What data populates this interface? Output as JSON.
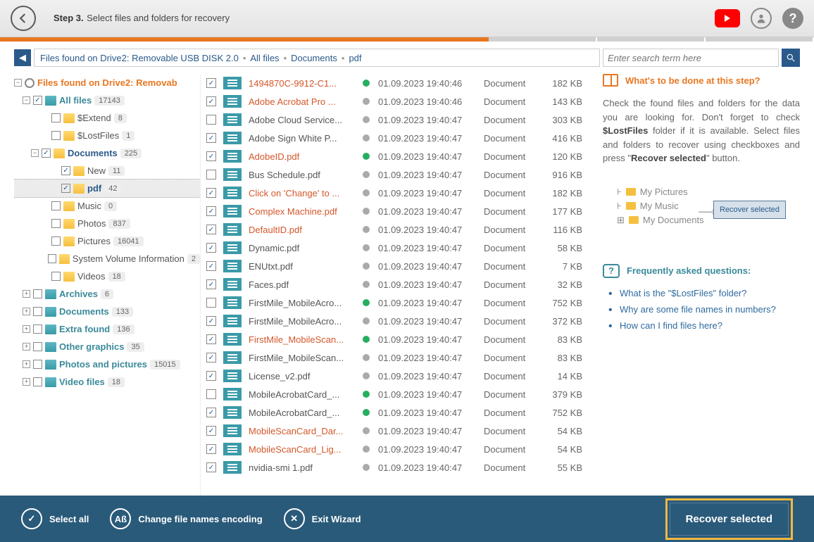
{
  "header": {
    "step": "Step 3.",
    "title": "Select files and folders for recovery"
  },
  "breadcrumb": {
    "root": "Files found on Drive2: Removable USB DISK 2.0",
    "p1": "All files",
    "p2": "Documents",
    "p3": "pdf"
  },
  "search": {
    "placeholder": "Enter search term here"
  },
  "tree": {
    "root": {
      "label": "Files found on Drive2: Removab"
    },
    "allfiles": {
      "label": "All files",
      "count": "17143"
    },
    "extend": {
      "label": "$Extend",
      "count": "8"
    },
    "lostfiles": {
      "label": "$LostFiles",
      "count": "1"
    },
    "documents": {
      "label": "Documents",
      "count": "225"
    },
    "new": {
      "label": "New",
      "count": "11"
    },
    "pdf": {
      "label": "pdf",
      "count": "42"
    },
    "music": {
      "label": "Music",
      "count": "0"
    },
    "photos": {
      "label": "Photos",
      "count": "837"
    },
    "pictures": {
      "label": "Pictures",
      "count": "16041"
    },
    "svi": {
      "label": "System Volume Information",
      "count": "2"
    },
    "videos": {
      "label": "Videos",
      "count": "18"
    },
    "archives": {
      "label": "Archives",
      "count": "6"
    },
    "docs2": {
      "label": "Documents",
      "count": "133"
    },
    "extrafound": {
      "label": "Extra found",
      "count": "136"
    },
    "othergfx": {
      "label": "Other graphics",
      "count": "35"
    },
    "photospics": {
      "label": "Photos and pictures",
      "count": "15015"
    },
    "videofiles": {
      "label": "Video files",
      "count": "18"
    }
  },
  "files": [
    {
      "chk": true,
      "name": "1494870C-9912-C1...",
      "health": "green",
      "date": "01.09.2023 19:40:46",
      "type": "Document",
      "size": "182 KB",
      "orange": true
    },
    {
      "chk": true,
      "name": "Adobe Acrobat Pro ...",
      "health": "gray",
      "date": "01.09.2023 19:40:46",
      "type": "Document",
      "size": "143 KB",
      "orange": true
    },
    {
      "chk": false,
      "name": "Adobe Cloud Service...",
      "health": "gray",
      "date": "01.09.2023 19:40:47",
      "type": "Document",
      "size": "303 KB",
      "orange": false
    },
    {
      "chk": true,
      "name": "Adobe Sign White P...",
      "health": "gray",
      "date": "01.09.2023 19:40:47",
      "type": "Document",
      "size": "416 KB",
      "orange": false
    },
    {
      "chk": true,
      "name": "AdobeID.pdf",
      "health": "green",
      "date": "01.09.2023 19:40:47",
      "type": "Document",
      "size": "120 KB",
      "orange": true
    },
    {
      "chk": false,
      "name": "Bus Schedule.pdf",
      "health": "gray",
      "date": "01.09.2023 19:40:47",
      "type": "Document",
      "size": "916 KB",
      "orange": false
    },
    {
      "chk": true,
      "name": "Click on 'Change' to ...",
      "health": "gray",
      "date": "01.09.2023 19:40:47",
      "type": "Document",
      "size": "182 KB",
      "orange": true
    },
    {
      "chk": true,
      "name": "Complex Machine.pdf",
      "health": "gray",
      "date": "01.09.2023 19:40:47",
      "type": "Document",
      "size": "177 KB",
      "orange": true
    },
    {
      "chk": true,
      "name": "DefaultID.pdf",
      "health": "gray",
      "date": "01.09.2023 19:40:47",
      "type": "Document",
      "size": "116 KB",
      "orange": true
    },
    {
      "chk": true,
      "name": "Dynamic.pdf",
      "health": "gray",
      "date": "01.09.2023 19:40:47",
      "type": "Document",
      "size": "58 KB",
      "orange": false
    },
    {
      "chk": true,
      "name": "ENUtxt.pdf",
      "health": "gray",
      "date": "01.09.2023 19:40:47",
      "type": "Document",
      "size": "7 KB",
      "orange": false
    },
    {
      "chk": true,
      "name": "Faces.pdf",
      "health": "gray",
      "date": "01.09.2023 19:40:47",
      "type": "Document",
      "size": "32 KB",
      "orange": false
    },
    {
      "chk": false,
      "name": "FirstMile_MobileAcro...",
      "health": "green",
      "date": "01.09.2023 19:40:47",
      "type": "Document",
      "size": "752 KB",
      "orange": false
    },
    {
      "chk": true,
      "name": "FirstMile_MobileAcro...",
      "health": "gray",
      "date": "01.09.2023 19:40:47",
      "type": "Document",
      "size": "372 KB",
      "orange": false
    },
    {
      "chk": true,
      "name": "FirstMile_MobileScan...",
      "health": "green",
      "date": "01.09.2023 19:40:47",
      "type": "Document",
      "size": "83 KB",
      "orange": true
    },
    {
      "chk": true,
      "name": "FirstMile_MobileScan...",
      "health": "gray",
      "date": "01.09.2023 19:40:47",
      "type": "Document",
      "size": "83 KB",
      "orange": false
    },
    {
      "chk": true,
      "name": "License_v2.pdf",
      "health": "gray",
      "date": "01.09.2023 19:40:47",
      "type": "Document",
      "size": "14 KB",
      "orange": false
    },
    {
      "chk": false,
      "name": "MobileAcrobatCard_...",
      "health": "green",
      "date": "01.09.2023 19:40:47",
      "type": "Document",
      "size": "379 KB",
      "orange": false
    },
    {
      "chk": true,
      "name": "MobileAcrobatCard_...",
      "health": "green",
      "date": "01.09.2023 19:40:47",
      "type": "Document",
      "size": "752 KB",
      "orange": false
    },
    {
      "chk": true,
      "name": "MobileScanCard_Dar...",
      "health": "gray",
      "date": "01.09.2023 19:40:47",
      "type": "Document",
      "size": "54 KB",
      "orange": true
    },
    {
      "chk": true,
      "name": "MobileScanCard_Lig...",
      "health": "gray",
      "date": "01.09.2023 19:40:47",
      "type": "Document",
      "size": "54 KB",
      "orange": true
    },
    {
      "chk": true,
      "name": "nvidia-smi 1.pdf",
      "health": "gray",
      "date": "01.09.2023 19:40:47",
      "type": "Document",
      "size": "55 KB",
      "orange": false
    }
  ],
  "right": {
    "title": "What's to be done at this step?",
    "text1": "Check the found files and folders for the data you are looking for. Don't forget to check ",
    "text2": "$LostFiles",
    "text3": " folder if it is available. Select files and folders to recover using checkboxes and press \"",
    "text4": "Recover selected",
    "text5": "\" button.",
    "img": {
      "i1": "My Pictures",
      "i2": "My Music",
      "i3": "My Documents",
      "btn": "Recover selected"
    },
    "faq_title": "Frequently asked questions:",
    "faq": [
      "What is the \"$LostFiles\" folder?",
      "Why are some file names in numbers?",
      "How can I find files here?"
    ]
  },
  "footer": {
    "selectall": "Select all",
    "encoding": "Change file names encoding",
    "exit": "Exit Wizard",
    "recover": "Recover selected"
  }
}
